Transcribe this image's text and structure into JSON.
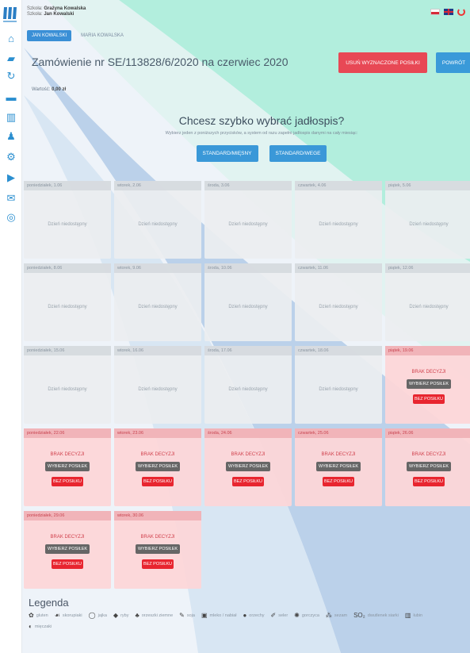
{
  "colors": {
    "accent_blue": "#3a98d8",
    "danger_red": "#e84855",
    "mint": "#a7ecd8"
  },
  "header": {
    "school_prefix": "Szkoła: ",
    "school_name": "Grażyna Kowalska",
    "child_prefix": "Szkoła: ",
    "child_name": "Jan Kowalski"
  },
  "tabs": [
    {
      "label": "JAN KOWALSKI",
      "active": true
    },
    {
      "label": "MARIA KOWALSKA",
      "active": false
    }
  ],
  "page": {
    "title": "Zamówienie nr SE/113828/6/2020 na czerwiec 2020",
    "delete_button": "USUŃ WYZNACZONE POSIŁKI",
    "back_button": "POWRÓT",
    "worth_label": "Wartość: ",
    "worth_value": "0,00 zł"
  },
  "quick": {
    "title": "Chcesz szybko wybrać jadłospis?",
    "subtitle": "Wybierz jeden z poniższych przycisków, a system od razu zapełni jadłospis danymi na cały miesiąc:",
    "buttons": [
      "STANDARD/MIĘSNY",
      "STANDARD/WEGE"
    ]
  },
  "labels": {
    "unavailable": "Dzień niedostępny",
    "no_decision": "BRAK DECYZJI",
    "choose_meal": "WYBIERZ POSIŁEK",
    "no_meal": "BEZ POSIŁKU"
  },
  "days": [
    {
      "label": "poniedziałek, 1.06",
      "status": "unavailable"
    },
    {
      "label": "wtorek, 2.06",
      "status": "unavailable"
    },
    {
      "label": "środa, 3.06",
      "status": "unavailable"
    },
    {
      "label": "czwartek, 4.06",
      "status": "unavailable"
    },
    {
      "label": "piątek, 5.06",
      "status": "unavailable"
    },
    {
      "label": "poniedziałek, 8.06",
      "status": "unavailable"
    },
    {
      "label": "wtorek, 9.06",
      "status": "unavailable"
    },
    {
      "label": "środa, 10.06",
      "status": "unavailable"
    },
    {
      "label": "czwartek, 11.06",
      "status": "unavailable"
    },
    {
      "label": "piątek, 12.06",
      "status": "unavailable"
    },
    {
      "label": "poniedziałek, 15.06",
      "status": "unavailable"
    },
    {
      "label": "wtorek, 16.06",
      "status": "unavailable"
    },
    {
      "label": "środa, 17.06",
      "status": "unavailable"
    },
    {
      "label": "czwartek, 18.06",
      "status": "unavailable"
    },
    {
      "label": "piątek, 19.06",
      "status": "pending"
    },
    {
      "label": "poniedziałek, 22.06",
      "status": "pending"
    },
    {
      "label": "wtorek, 23.06",
      "status": "pending"
    },
    {
      "label": "środa, 24.06",
      "status": "pending"
    },
    {
      "label": "czwartek, 25.06",
      "status": "pending"
    },
    {
      "label": "piątek, 26.06",
      "status": "pending"
    },
    {
      "label": "poniedziałek, 29.06",
      "status": "pending"
    },
    {
      "label": "wtorek, 30.06",
      "status": "pending"
    }
  ],
  "legend": {
    "title": "Legenda",
    "items": [
      {
        "label": "gluten",
        "icon": "wheat-icon",
        "glyph": "✿"
      },
      {
        "label": "skorupiaki",
        "icon": "shrimp-icon",
        "glyph": "☙"
      },
      {
        "label": "jajka",
        "icon": "egg-icon",
        "glyph": "◯"
      },
      {
        "label": "ryby",
        "icon": "fish-icon",
        "glyph": "◆"
      },
      {
        "label": "orzeszki ziemne",
        "icon": "peanut-icon",
        "glyph": "♣"
      },
      {
        "label": "soja",
        "icon": "soy-icon",
        "glyph": "✎"
      },
      {
        "label": "mleko / nabiał",
        "icon": "milk-icon",
        "glyph": "▣"
      },
      {
        "label": "orzechy",
        "icon": "nut-icon",
        "glyph": "●"
      },
      {
        "label": "seler",
        "icon": "celery-icon",
        "glyph": "✐"
      },
      {
        "label": "gorczyca",
        "icon": "mustard-icon",
        "glyph": "✺"
      },
      {
        "label": "sezam",
        "icon": "sesame-icon",
        "glyph": "⁂"
      },
      {
        "label": "dwutlenek siarki",
        "icon": "sulfur-icon",
        "glyph": "SO₂"
      },
      {
        "label": "łubin",
        "icon": "lupin-icon",
        "glyph": "▥"
      },
      {
        "label": "mięczaki",
        "icon": "mollusc-icon",
        "glyph": "◐"
      }
    ]
  }
}
